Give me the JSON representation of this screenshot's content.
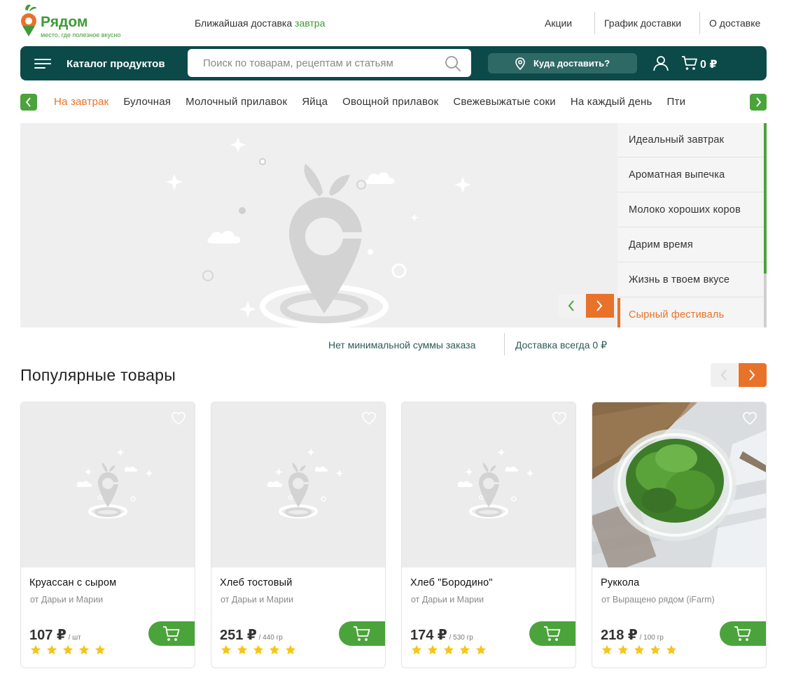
{
  "header": {
    "logo_name": "Рядом",
    "logo_tagline": "место, где полезное вкусно",
    "delivery_prefix": "Ближайшая доставка",
    "delivery_day": "завтра",
    "links": [
      "Акции",
      "График доставки",
      "О доставке"
    ]
  },
  "navbar": {
    "catalog_label": "Каталог продуктов",
    "search_placeholder": "Поиск по товарам, рецептам и статьям",
    "address_label": "Куда доставить?",
    "cart_total": "0 ₽"
  },
  "categories": {
    "items": [
      "На завтрак",
      "Булочная",
      "Молочный прилавок",
      "Яйца",
      "Овощной прилавок",
      "Свежевыжатые соки",
      "На каждый день",
      "Пти"
    ],
    "active_index": 0
  },
  "promos": {
    "items": [
      "Идеальный завтрак",
      "Ароматная выпечка",
      "Молоко хороших коров",
      "Дарим время",
      "Жизнь в твоем вкусе",
      "Сырный фестиваль"
    ],
    "active_index": 5
  },
  "notes": {
    "no_minimum": "Нет минимальной суммы заказа",
    "free_delivery": "Доставка всегда 0 ₽"
  },
  "popular": {
    "title": "Популярные товары",
    "products": [
      {
        "name": "Круассан с сыром",
        "maker": "от Дарьи и Марии",
        "price": "107 ₽",
        "unit": " / шт",
        "rating": 5,
        "has_photo": false
      },
      {
        "name": "Хлеб тостовый",
        "maker": "от Дарьи и Марии",
        "price": "251 ₽",
        "unit": " / 440 гр",
        "rating": 5,
        "has_photo": false
      },
      {
        "name": "Хлеб \"Бородино\"",
        "maker": "от Дарьи и Марии",
        "price": "174 ₽",
        "unit": " / 530 гр",
        "rating": 5,
        "has_photo": false
      },
      {
        "name": "Руккола",
        "maker": "от Выращено рядом (iFarm)",
        "price": "218 ₽",
        "unit": " / 100 гр",
        "rating": 5,
        "has_photo": true
      }
    ]
  },
  "colors": {
    "brand_green": "#4ba33b",
    "dark_teal": "#0b4a48",
    "accent_orange": "#e8722a",
    "star": "#f5c518"
  },
  "icons": {
    "menu": "hamburger-icon",
    "search": "search-icon",
    "location": "location-pin-icon",
    "user": "user-icon",
    "cart": "cart-icon",
    "favorite": "heart-icon",
    "star": "star-icon"
  }
}
